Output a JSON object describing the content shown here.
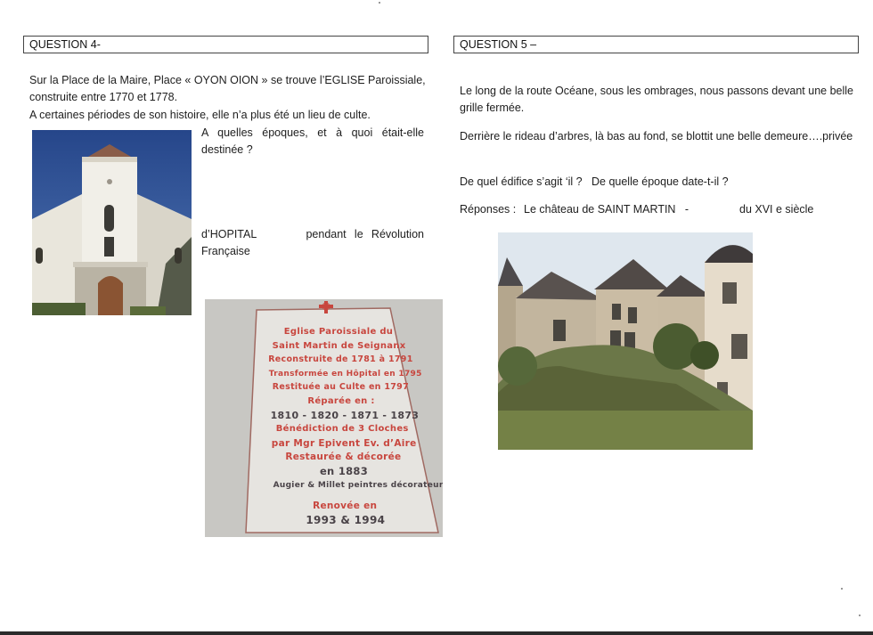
{
  "left": {
    "question_label": "QUESTION 4-",
    "p1_line1": "Sur la Place de la Maire, Place « OYON OION » se trouve l’EGLISE Paroissiale,",
    "p1_line2": "construite entre 1770 et 1778.",
    "p1_line3": "A certaines périodes de son histoire, elle n’a plus été un lieu de culte.",
    "question_text": "A quelles époques, et à quoi était-elle destinée ?",
    "answer_text": "d’HOPITAL      pendant le Révolution Française"
  },
  "plaque": {
    "lines": [
      {
        "text": "Eglise Paroissiale du",
        "color": "red"
      },
      {
        "text": "Saint Martin de Seignanx",
        "color": "red"
      },
      {
        "text": "Reconstruite de 1781 à 1791",
        "color": "red"
      },
      {
        "text": "Transformée en Hôpital en 1795",
        "color": "red"
      },
      {
        "text": "Restituée au Culte en 1797",
        "color": "red"
      },
      {
        "text": "Réparée en :",
        "color": "red"
      },
      {
        "text": "1810 - 1820 - 1871 - 1873",
        "color": "dark"
      },
      {
        "text": "Bénédiction de 3 Cloches",
        "color": "red"
      },
      {
        "text": "par Mgr Epivent Ev. d’Aire",
        "color": "red"
      },
      {
        "text": "Restaurée & décorée",
        "color": "red"
      },
      {
        "text": "en 1883",
        "color": "dark"
      },
      {
        "text": "Augier & Millet peintres décorateurs",
        "color": "dark"
      },
      {
        "text": "Renovée en",
        "color": "red"
      },
      {
        "text": "1993 & 1994",
        "color": "dark"
      }
    ]
  },
  "right": {
    "question_label": "QUESTION 5 –",
    "p1": "Le long de la route Océane, sous les ombrages, nous passons devant une belle grille fermée.",
    "p2": "Derrière le rideau d’arbres, là bas au fond, se blottit une belle demeure….privée",
    "p3": "De quel édifice s’agit ‘il ?   De quelle époque date-t-il ?",
    "answer_label": "Réponses :",
    "answer_text": "Le château de SAINT MARTIN   -",
    "answer_period": "du XVI e siècle"
  },
  "colors": {
    "plaque_red": "#c8463e",
    "plaque_dark": "#4a4348",
    "sky_blue": "#2c4f93"
  }
}
